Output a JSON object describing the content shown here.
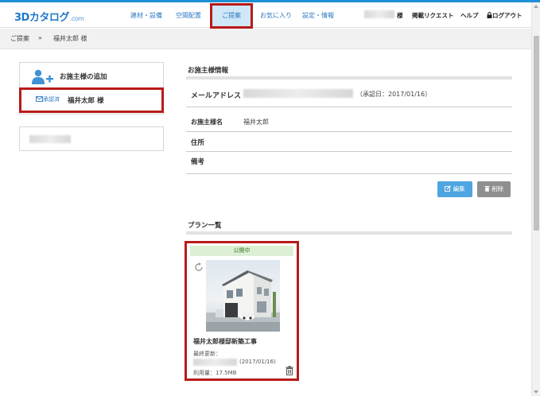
{
  "header": {
    "logo": "3Dカタログ",
    "logo_suffix": ".com",
    "nav": [
      {
        "label": "建材・設備"
      },
      {
        "label": "空間配置"
      },
      {
        "label": "ご提案"
      },
      {
        "label": "お気に入り"
      },
      {
        "label": "設定・情報"
      }
    ],
    "user_suffix": "様",
    "request_label": "掲載リクエスト",
    "help_label": "ヘルプ",
    "logout_label": "ログアウト"
  },
  "breadcrumb": {
    "root": "ご提案",
    "separator": "»",
    "current": "福井太郎 様"
  },
  "sidebar": {
    "add_client_label": "お施主様の追加",
    "client_status": "承認済",
    "client_name": "福井太郎 様"
  },
  "client_info": {
    "title": "お施主様情報",
    "email_label": "メールアドレス",
    "approved_text": "（承認日：2017/01/16）",
    "name_label": "お施主様名",
    "name_value": "福井太郎",
    "address_label": "住所",
    "notes_label": "備考",
    "edit_label": "編集",
    "delete_label": "削除"
  },
  "plans": {
    "title": "プラン一覧",
    "items": [
      {
        "status": "公開中",
        "name": "福井太郎様邸新築工事",
        "updated_label": "最終更新：",
        "updated_date": "(2017/01/16)",
        "usage": "利用量：17.5MB"
      }
    ]
  },
  "colors": {
    "accent": "#2a78c0",
    "highlight_border": "#b81a1a",
    "edit_button": "#4ea5df",
    "delete_button": "#8f8f8f",
    "public_badge": "#dcefd4"
  }
}
